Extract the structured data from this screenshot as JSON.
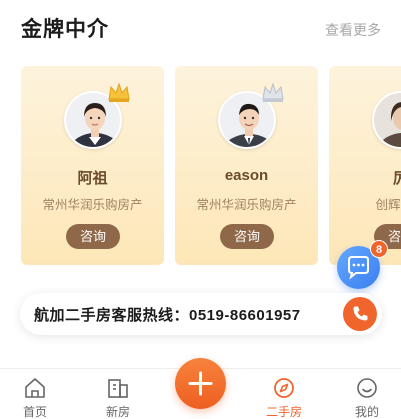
{
  "section": {
    "title": "金牌中介",
    "view_more": "查看更多"
  },
  "agents": [
    {
      "name": "阿祖",
      "company": "常州华润乐购房产",
      "button": "咨询"
    },
    {
      "name": "eason",
      "company": "常州华润乐购房产",
      "button": "咨询"
    },
    {
      "name": "厉",
      "company": "创辉房产",
      "button": "咨询"
    }
  ],
  "chat": {
    "badge": "8",
    "icon": "chat-bubble-icon"
  },
  "hotline": {
    "text": "航加二手房客服热线：0519-86601957",
    "icon": "phone-icon"
  },
  "tabbar": {
    "items": [
      {
        "label": "首页",
        "icon": "home-icon",
        "active": false
      },
      {
        "label": "新房",
        "icon": "building-icon",
        "active": false
      },
      {
        "label": "二手房",
        "icon": "compass-icon",
        "active": true
      },
      {
        "label": "我的",
        "icon": "smile-icon",
        "active": false
      }
    ],
    "center_icon": "plus-icon"
  },
  "colors": {
    "accent": "#f0652b",
    "chat": "#3b7ff0",
    "card_bg": "#fde7b8",
    "button_brown": "#8e6848"
  }
}
